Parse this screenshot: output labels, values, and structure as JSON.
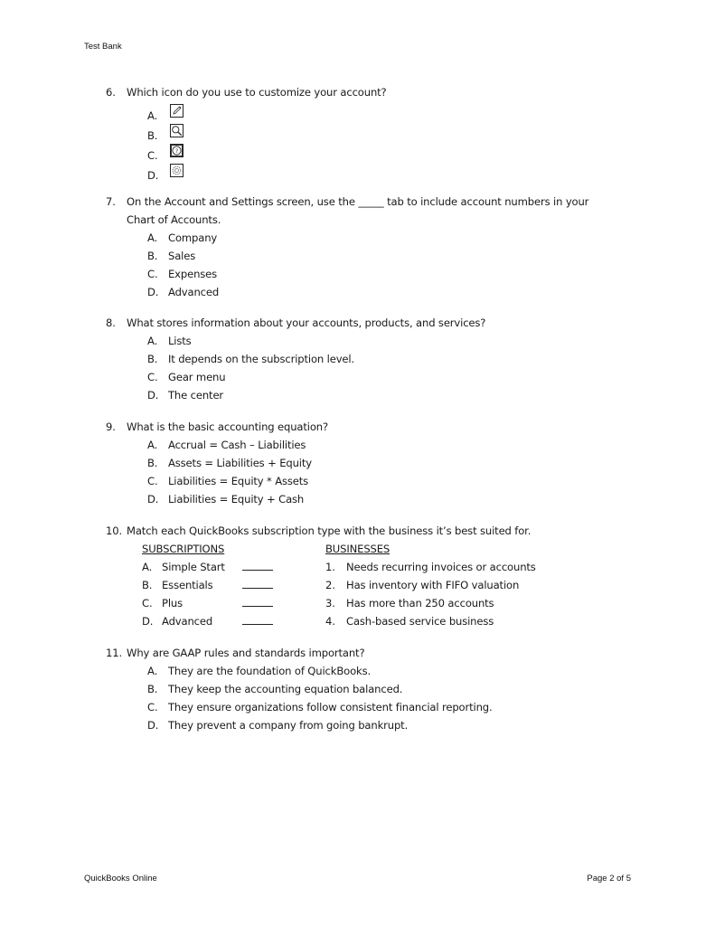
{
  "header": {
    "title": "Test Bank"
  },
  "footer": {
    "left": "QuickBooks Online",
    "right": "Page 2 of 5"
  },
  "questions": {
    "q6": {
      "number": "6.",
      "text": "Which icon do you use to customize your account?",
      "options": [
        {
          "letter": "A.",
          "icon": "pencil-icon"
        },
        {
          "letter": "B.",
          "icon": "magnifier-icon"
        },
        {
          "letter": "C.",
          "icon": "help-question-icon"
        },
        {
          "letter": "D.",
          "icon": "gear-icon"
        }
      ]
    },
    "q7": {
      "number": "7.",
      "text_line1": "On the Account and Settings screen, use the _____ tab to include account numbers in your",
      "text_line2": "Chart of Accounts.",
      "options": [
        {
          "letter": "A.",
          "text": "Company"
        },
        {
          "letter": "B.",
          "text": "Sales"
        },
        {
          "letter": "C.",
          "text": "Expenses"
        },
        {
          "letter": "D.",
          "text": "Advanced"
        }
      ]
    },
    "q8": {
      "number": "8.",
      "text": "What stores information about your accounts, products, and services?",
      "options": [
        {
          "letter": "A.",
          "text": "Lists"
        },
        {
          "letter": "B.",
          "text": "It depends on the subscription level."
        },
        {
          "letter": "C.",
          "text": "Gear menu"
        },
        {
          "letter": "D.",
          "text": "The center"
        }
      ]
    },
    "q9": {
      "number": "9.",
      "text": "What is the basic accounting equation?",
      "options": [
        {
          "letter": "A.",
          "text": "Accrual = Cash – Liabilities"
        },
        {
          "letter": "B.",
          "text": "Assets = Liabilities + Equity"
        },
        {
          "letter": "C.",
          "text": "Liabilities = Equity * Assets"
        },
        {
          "letter": "D.",
          "text": "Liabilities = Equity + Cash"
        }
      ]
    },
    "q10": {
      "number": "10.",
      "text": "Match each QuickBooks subscription type with the business it’s best suited for.",
      "left_heading": "SUBSCRIPTIONS",
      "right_heading": "BUSINESSES",
      "subscriptions": [
        {
          "letter": "A.",
          "text": "Simple Start"
        },
        {
          "letter": "B.",
          "text": "Essentials"
        },
        {
          "letter": "C.",
          "text": "Plus"
        },
        {
          "letter": "D.",
          "text": "Advanced"
        }
      ],
      "businesses": [
        {
          "number": "1.",
          "text": "Needs recurring invoices or accounts"
        },
        {
          "number": "2.",
          "text": "Has inventory with FIFO valuation"
        },
        {
          "number": "3.",
          "text": "Has more than 250 accounts"
        },
        {
          "number": "4.",
          "text": "Cash-based service business"
        }
      ]
    },
    "q11": {
      "number": "11.",
      "text": "Why are GAAP rules and standards important?",
      "options": [
        {
          "letter": "A.",
          "text": "They are the foundation of QuickBooks."
        },
        {
          "letter": "B.",
          "text": "They keep the accounting equation balanced."
        },
        {
          "letter": "C.",
          "text": "They ensure organizations follow consistent financial reporting."
        },
        {
          "letter": "D.",
          "text": "They prevent a company from going bankrupt."
        }
      ]
    }
  }
}
